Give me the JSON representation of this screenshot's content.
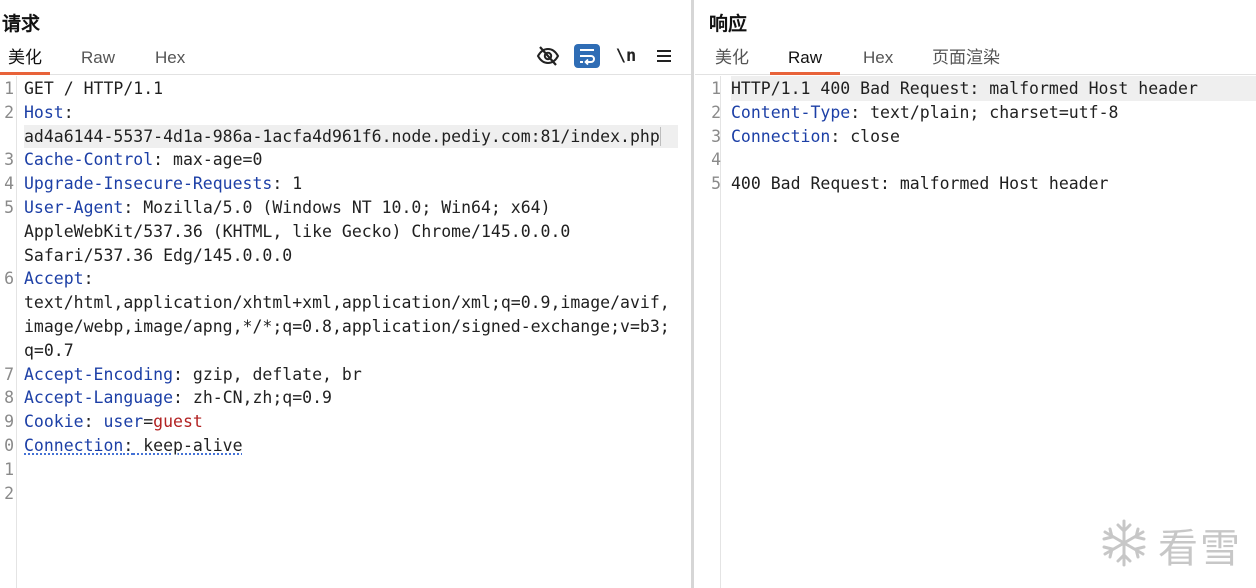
{
  "request": {
    "title": "请求",
    "tabs": [
      "美化",
      "Raw",
      "Hex"
    ],
    "active_tab": "美化",
    "toolbar_icons": [
      "eye-slash-icon",
      "wrap-lines-icon",
      "newline-icon",
      "menu-icon"
    ],
    "newline_label": "\\n",
    "lines": {
      "l1": {
        "num": "1",
        "text": "GET / HTTP/1.1"
      },
      "l2": {
        "num": "2",
        "key": "Host",
        "sep": ":"
      },
      "l2b": {
        "text": "ad4a6144-5537-4d1a-986a-1acfa4d961f6.node.pediy.com:81/index.php"
      },
      "l3": {
        "num": "3",
        "key": "Cache-Control",
        "sep": ":",
        "value": " max-age=0"
      },
      "l4": {
        "num": "4",
        "key": "Upgrade-Insecure-Requests",
        "sep": ":",
        "value": " 1"
      },
      "l5": {
        "num": "5",
        "key": "User-Agent",
        "sep": ":",
        "value": " Mozilla/5.0 (Windows NT 10.0; Win64; x64)"
      },
      "l5b": {
        "text": "AppleWebKit/537.36 (KHTML, like Gecko) Chrome/145.0.0.0"
      },
      "l5c": {
        "text": "Safari/537.36 Edg/145.0.0.0"
      },
      "l6": {
        "num": "6",
        "key": "Accept",
        "sep": ":"
      },
      "l6b": {
        "text": "text/html,application/xhtml+xml,application/xml;q=0.9,image/avif,"
      },
      "l6c": {
        "text": "image/webp,image/apng,*/*;q=0.8,application/signed-exchange;v=b3;"
      },
      "l6d": {
        "text": "q=0.7"
      },
      "l7": {
        "num": "7",
        "key": "Accept-Encoding",
        "sep": ":",
        "value": " gzip, deflate, br"
      },
      "l8": {
        "num": "8",
        "key": "Accept-Language",
        "sep": ":",
        "value": " zh-CN,zh;q=0.9"
      },
      "l9": {
        "num": "9",
        "key": "Cookie",
        "sep": ":",
        "cookie_name": " user",
        "eq": "=",
        "cookie_value": "guest"
      },
      "l10": {
        "num": "0",
        "key": "Connection",
        "sep": ":",
        "value": " keep-alive"
      },
      "l11": {
        "num": "1"
      },
      "l12": {
        "num": "2"
      }
    }
  },
  "response": {
    "title": "响应",
    "tabs": [
      "美化",
      "Raw",
      "Hex",
      "页面渲染"
    ],
    "active_tab": "Raw",
    "lines": {
      "l1": {
        "num": "1",
        "text": "HTTP/1.1 400 Bad Request: malformed Host header"
      },
      "l2": {
        "num": "2",
        "key": "Content-Type",
        "sep": ":",
        "value": " text/plain; charset=utf-8"
      },
      "l3": {
        "num": "3",
        "key": "Connection",
        "sep": ":",
        "value": " close"
      },
      "l4": {
        "num": "4"
      },
      "l5": {
        "num": "5",
        "text": "400 Bad Request: malformed Host header"
      }
    }
  },
  "watermark": {
    "text": "看雪",
    "icon": "snowflake-icon"
  },
  "colors": {
    "accent": "#e8633a",
    "header_key": "#1c3fa6",
    "cookie_value": "#b22222",
    "wrap_button_bg": "#2f6db5"
  }
}
